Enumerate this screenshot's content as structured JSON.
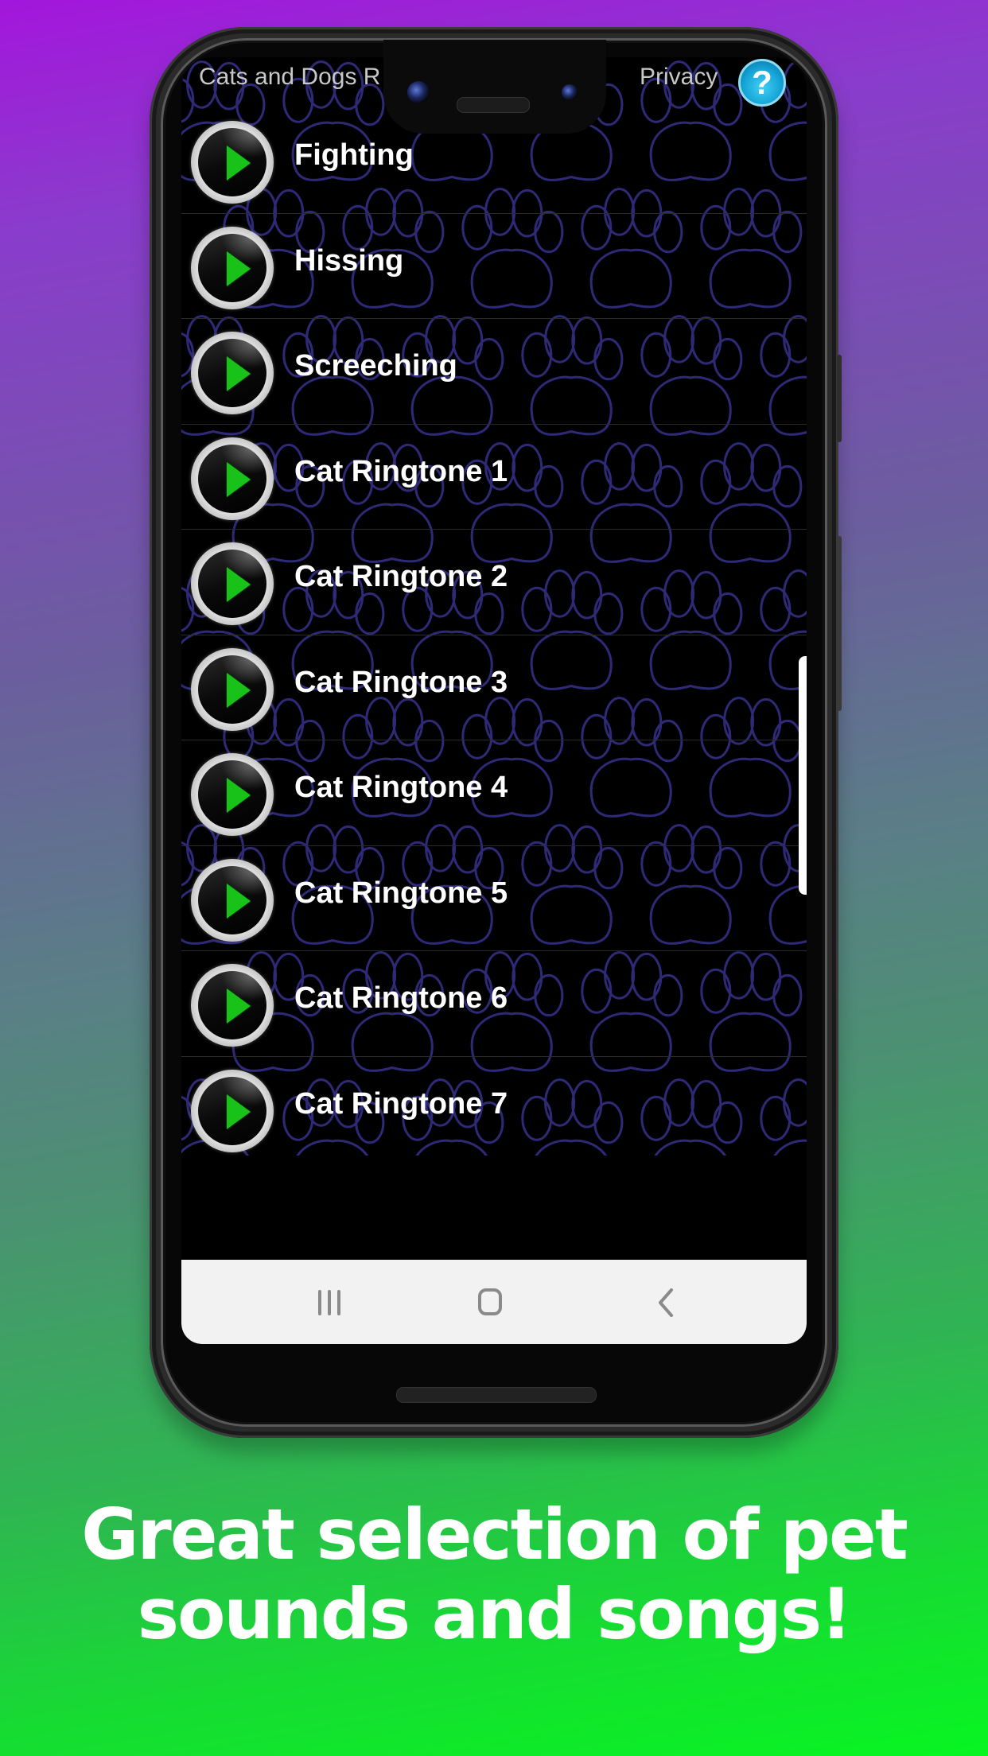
{
  "app": {
    "title": "Cats and Dogs Ringtones",
    "privacy_label": "Privacy",
    "help_icon_label": "?"
  },
  "sound_list": [
    {
      "label": "Fighting"
    },
    {
      "label": "Hissing"
    },
    {
      "label": "Screeching"
    },
    {
      "label": "Cat Ringtone 1"
    },
    {
      "label": "Cat Ringtone 2"
    },
    {
      "label": "Cat Ringtone 3"
    },
    {
      "label": "Cat Ringtone 4"
    },
    {
      "label": "Cat Ringtone 5"
    },
    {
      "label": "Cat Ringtone 6"
    },
    {
      "label": "Cat Ringtone 7"
    }
  ],
  "navbar": {
    "recents": "recents-icon",
    "home": "home-icon",
    "back": "back-icon"
  },
  "promo": {
    "line1": "Great selection of pet",
    "line2": "sounds and songs!"
  },
  "colors": {
    "play_triangle": "#18c218",
    "paw_outline": "#2e2a78",
    "help_button": "#15a3d6",
    "bg_top": "#a316dc",
    "bg_bottom": "#08f522"
  }
}
